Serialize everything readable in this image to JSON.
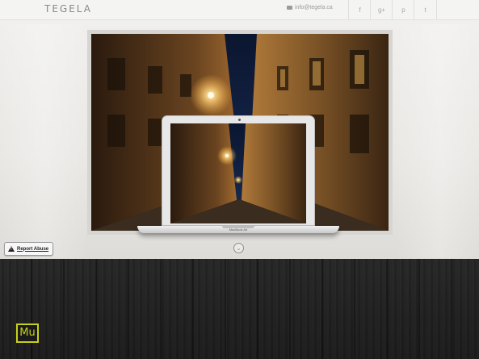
{
  "header": {
    "logo": "TEGELA",
    "email": "info@tegela.ca",
    "social": [
      {
        "icon": "facebook-icon",
        "glyph": "f"
      },
      {
        "icon": "google-plus-icon",
        "glyph": "g+"
      },
      {
        "icon": "pinterest-icon",
        "glyph": "p"
      },
      {
        "icon": "twitter-icon",
        "glyph": "t"
      }
    ]
  },
  "hero": {
    "laptop_brand": "MacBook Air",
    "scroll_glyph": "⌄"
  },
  "report": {
    "label": "Report Abuse"
  },
  "badge": {
    "label": "Mu",
    "color": "#c7d11a"
  }
}
